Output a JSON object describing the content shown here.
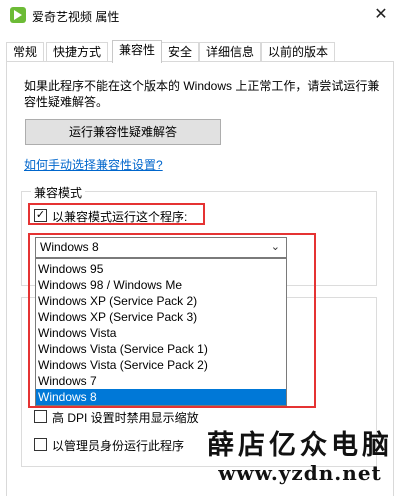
{
  "window": {
    "title": "爱奇艺视频 属性",
    "close_glyph": "✕"
  },
  "tabs": [
    {
      "label": "常规"
    },
    {
      "label": "快捷方式"
    },
    {
      "label": "兼容性"
    },
    {
      "label": "安全"
    },
    {
      "label": "详细信息"
    },
    {
      "label": "以前的版本"
    }
  ],
  "active_tab": "兼容性",
  "compat": {
    "description_line1": "如果此程序不能在这个版本的 Windows 上正常工作，请尝试运行兼",
    "description_line2": "容性疑难解答。",
    "troubleshoot_button": "运行兼容性疑难解答",
    "manual_link": "如何手动选择兼容性设置?",
    "group_title": "兼容模式",
    "checkbox_label": "以兼容模式运行这个程序:",
    "checkbox_checked": true,
    "checkbox_glyph": "✓",
    "selected_os": "Windows 8",
    "chevron_glyph": "⌄",
    "options": [
      "Windows 95",
      "Windows 98 / Windows Me",
      "Windows XP (Service Pack 2)",
      "Windows XP (Service Pack 3)",
      "Windows Vista",
      "Windows Vista (Service Pack 1)",
      "Windows Vista (Service Pack 2)",
      "Windows 7",
      "Windows 8"
    ],
    "highlighted_option": "Windows 8"
  },
  "settings": {
    "dpi_label": "高 DPI 设置时禁用显示缩放",
    "admin_label": "以管理员身份运行此程序"
  },
  "watermark": {
    "line1": "薛店亿众电脑",
    "line2": "www.yzdn.net"
  },
  "colors": {
    "highlight": "#e53333",
    "selection": "#0078d7",
    "link": "#0066cc"
  }
}
